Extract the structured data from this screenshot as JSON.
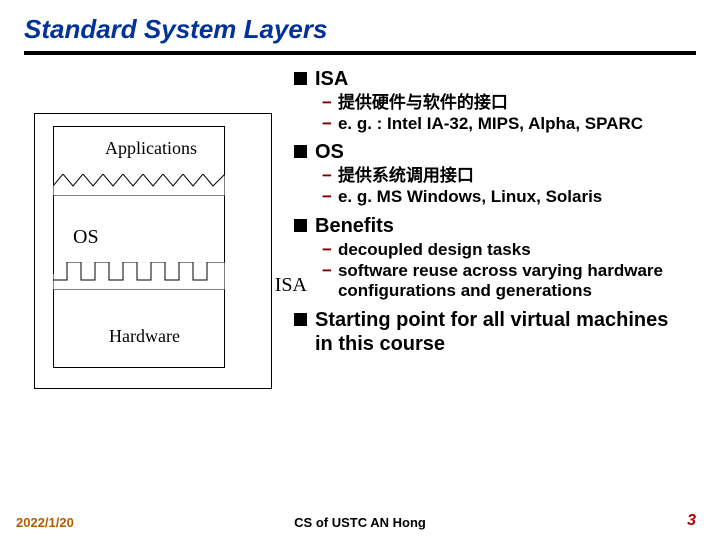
{
  "title": "Standard System Layers",
  "diagram": {
    "apps": "Applications",
    "os": "OS",
    "isa": "ISA",
    "hw": "Hardware"
  },
  "bullets": {
    "isa": {
      "heading": "ISA",
      "sub1": "提供硬件与软件的接口",
      "sub2": "e. g. : Intel IA-32, MIPS, Alpha, SPARC"
    },
    "os": {
      "heading": "OS",
      "sub1": "提供系统调用接口",
      "sub2": "e. g. MS Windows, Linux, Solaris"
    },
    "benefits": {
      "heading": "Benefits",
      "sub1": "decoupled design tasks",
      "sub2": "software reuse across varying hardware configurations and generations"
    },
    "start": {
      "heading": "Starting point for all virtual machines in this course"
    }
  },
  "footer": {
    "date": "2022/1/20",
    "center": "CS of USTC AN Hong",
    "page": "3"
  }
}
